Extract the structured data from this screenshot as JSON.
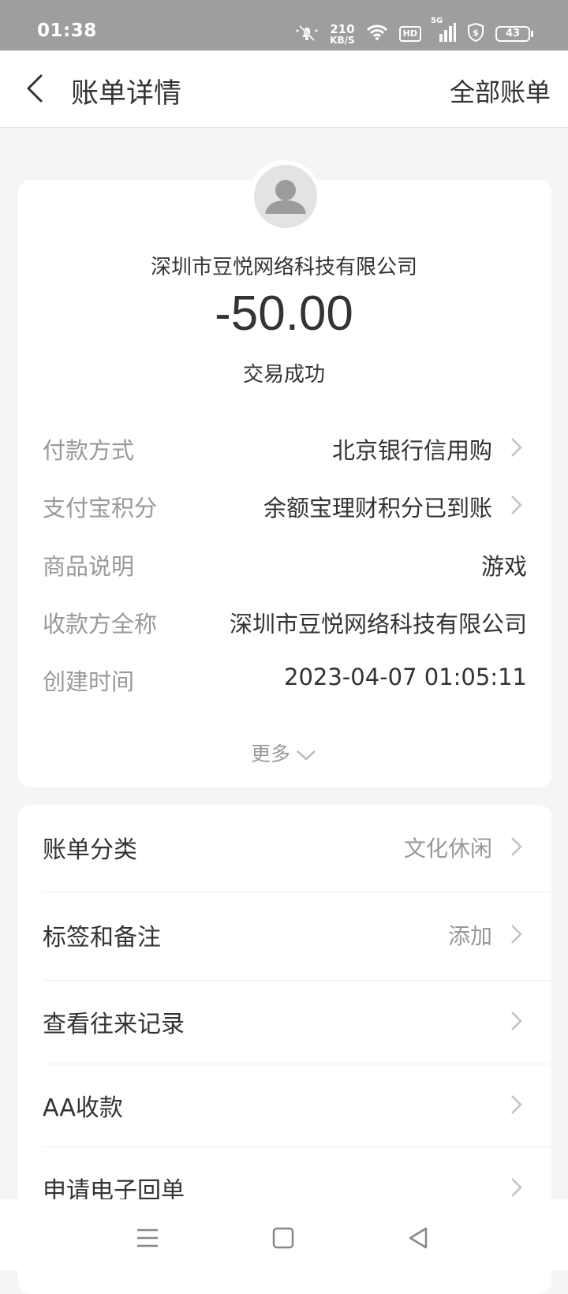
{
  "status_bar": {
    "time": "01:38",
    "net_speed_value": "210",
    "net_speed_unit": "KB/S",
    "hd_badge": "HD",
    "signal_label": "5G",
    "battery": "43",
    "icons": [
      "mute-bell-icon",
      "wifi-icon",
      "hd-icon",
      "signal-icon",
      "shield-dollar-icon",
      "battery-icon"
    ]
  },
  "header": {
    "title": "账单详情",
    "right_link": "全部账单"
  },
  "summary": {
    "merchant": "深圳市豆悦网络科技有限公司",
    "amount": "-50.00",
    "status": "交易成功"
  },
  "details": [
    {
      "label": "付款方式",
      "value": "北京银行信用购",
      "has_chevron": true
    },
    {
      "label": "支付宝积分",
      "value": "余额宝理财积分已到账",
      "has_chevron": true
    },
    {
      "label": "商品说明",
      "value": "游戏",
      "has_chevron": false
    },
    {
      "label": "收款方全称",
      "value": "深圳市豆悦网络科技有限公司",
      "has_chevron": false
    },
    {
      "label": "创建时间",
      "value": "2023-04-07 01:05:11",
      "has_chevron": false
    }
  ],
  "more_label": "更多",
  "menu": [
    {
      "label": "账单分类",
      "value": "文化休闲"
    },
    {
      "label": "标签和备注",
      "value": "添加"
    },
    {
      "label": "查看往来记录",
      "value": ""
    },
    {
      "label": "AA收款",
      "value": ""
    },
    {
      "label": "申请电子回单",
      "value": ""
    }
  ]
}
